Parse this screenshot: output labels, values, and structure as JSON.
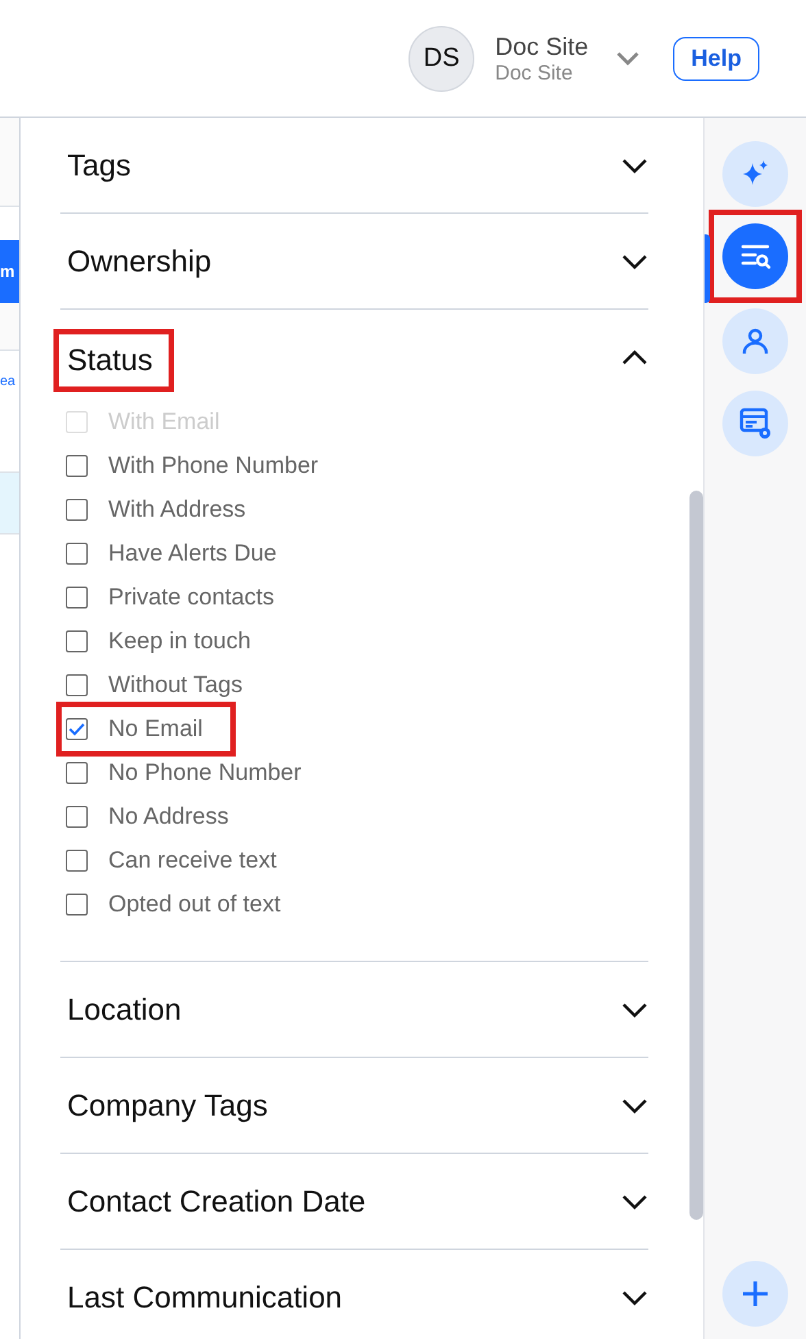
{
  "header": {
    "avatar": "DS",
    "account_name": "Doc Site",
    "account_sub": "Doc Site",
    "help": "Help"
  },
  "left_strip": {
    "button": "m",
    "link": "ea"
  },
  "sections": [
    {
      "title": "Tags",
      "expanded": false,
      "highlighted": false
    },
    {
      "title": "Ownership",
      "expanded": false,
      "highlighted": false
    },
    {
      "title": "Status",
      "expanded": true,
      "highlighted": true,
      "options": [
        {
          "label": "With Email",
          "checked": false,
          "disabled": true,
          "highlighted": false
        },
        {
          "label": "With Phone Number",
          "checked": false,
          "disabled": false,
          "highlighted": false
        },
        {
          "label": "With Address",
          "checked": false,
          "disabled": false,
          "highlighted": false
        },
        {
          "label": "Have Alerts Due",
          "checked": false,
          "disabled": false,
          "highlighted": false
        },
        {
          "label": "Private contacts",
          "checked": false,
          "disabled": false,
          "highlighted": false
        },
        {
          "label": "Keep in touch",
          "checked": false,
          "disabled": false,
          "highlighted": false
        },
        {
          "label": "Without Tags",
          "checked": false,
          "disabled": false,
          "highlighted": false
        },
        {
          "label": "No Email",
          "checked": true,
          "disabled": false,
          "highlighted": true
        },
        {
          "label": "No Phone Number",
          "checked": false,
          "disabled": false,
          "highlighted": false
        },
        {
          "label": "No Address",
          "checked": false,
          "disabled": false,
          "highlighted": false
        },
        {
          "label": "Can receive text",
          "checked": false,
          "disabled": false,
          "highlighted": false
        },
        {
          "label": "Opted out of text",
          "checked": false,
          "disabled": false,
          "highlighted": false
        }
      ]
    },
    {
      "title": "Location",
      "expanded": false,
      "highlighted": false
    },
    {
      "title": "Company Tags",
      "expanded": false,
      "highlighted": false
    },
    {
      "title": "Contact Creation Date",
      "expanded": false,
      "highlighted": false
    },
    {
      "title": "Last Communication",
      "expanded": false,
      "highlighted": false
    }
  ],
  "rail": [
    {
      "kind": "sparkle",
      "selected": false,
      "highlighted": false
    },
    {
      "kind": "filter",
      "selected": true,
      "highlighted": true
    },
    {
      "kind": "person",
      "selected": false,
      "highlighted": false
    },
    {
      "kind": "settings",
      "selected": false,
      "highlighted": false
    }
  ],
  "add_button": {
    "kind": "plus"
  }
}
